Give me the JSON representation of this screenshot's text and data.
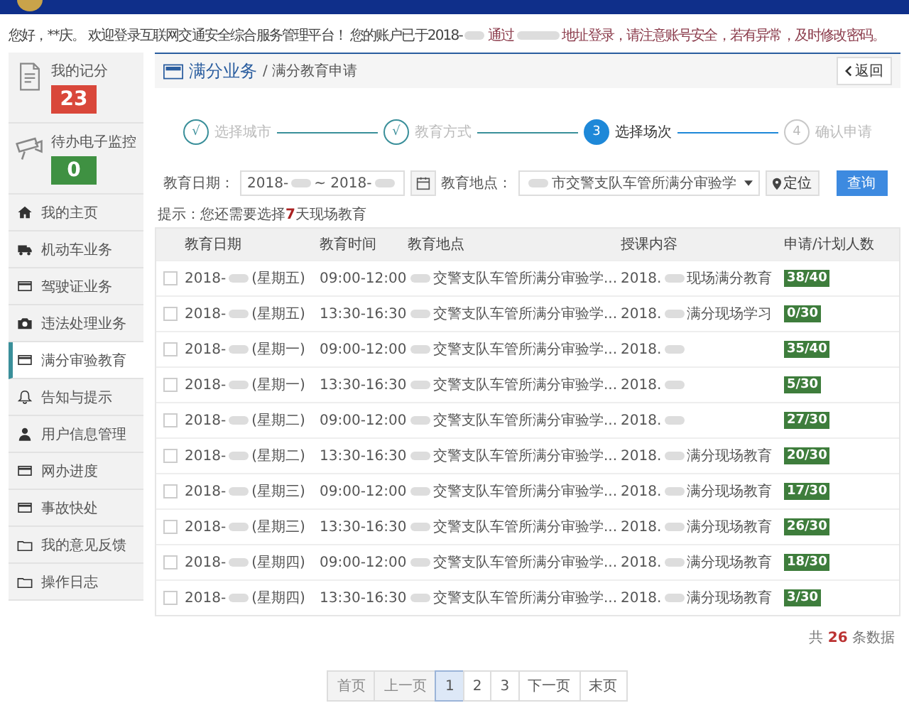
{
  "greeting": {
    "before": "您好，**庆。 欢迎登录互联网交通安全综合服务管理平台！ 您的账户已于2018-",
    "middle": "通过",
    "after": "地址登录，请注意账号安全，若有异常，及时修改密码。"
  },
  "sidebar": {
    "cards": [
      {
        "label": "我的记分",
        "value": "23",
        "color": "#d9473a"
      },
      {
        "label": "待办电子监控",
        "value": "0",
        "color": "#3f9142"
      }
    ],
    "items": [
      {
        "label": "我的主页",
        "selected": false
      },
      {
        "label": "机动车业务",
        "selected": false
      },
      {
        "label": "驾驶证业务",
        "selected": false
      },
      {
        "label": "违法处理业务",
        "selected": false
      },
      {
        "label": "满分审验教育",
        "selected": true
      },
      {
        "label": "告知与提示",
        "selected": false
      },
      {
        "label": "用户信息管理",
        "selected": false
      },
      {
        "label": "网办进度",
        "selected": false
      },
      {
        "label": "事故快处",
        "selected": false
      },
      {
        "label": "我的意见反馈",
        "selected": false
      },
      {
        "label": "操作日志",
        "selected": false
      }
    ]
  },
  "breadcrumb": {
    "section": "满分业务",
    "page": "/ 满分教育申请",
    "back": "返回"
  },
  "steps": [
    {
      "marker": "√",
      "label": "选择城市",
      "kind": "done"
    },
    {
      "marker": "√",
      "label": "教育方式",
      "kind": "done"
    },
    {
      "marker": "3",
      "label": "选择场次",
      "kind": "current"
    },
    {
      "marker": "4",
      "label": "确认申请",
      "kind": "todo"
    }
  ],
  "filters": {
    "date_label": "教育日期：",
    "date_from": "2018-",
    "date_to": "~ 2018-",
    "place_label": "教育地点：",
    "place_value": "市交警支队车管所满分审验学",
    "locate": "定位",
    "search": "查询"
  },
  "hint": "提示：您还需要选择**7**天现场教育",
  "table": {
    "columns": [
      "教育日期",
      "教育时间",
      "教育地点",
      "授课内容",
      "申请/计划人数"
    ],
    "rows": [
      {
        "date": "2018-",
        "weekday": "(星期五)",
        "time": "09:00-12:00",
        "place": "交警支队车管所满分审验学...",
        "content_prefix": "2018.",
        "content": "现场满分教育",
        "count": "38/40",
        "checked": false
      },
      {
        "date": "2018-",
        "weekday": "(星期五)",
        "time": "13:30-16:30",
        "place": "交警支队车管所满分审验学...",
        "content_prefix": "2018.",
        "content": "满分现场学习",
        "count": "0/30",
        "checked": false
      },
      {
        "date": "2018-",
        "weekday": "(星期一)",
        "time": "09:00-12:00",
        "place": "交警支队车管所满分审验学...",
        "content_prefix": "2018.",
        "count": "35/40",
        "checked": false
      },
      {
        "date": "2018-",
        "weekday": "(星期一)",
        "time": "13:30-16:30",
        "place": "交警支队车管所满分审验学...",
        "content_prefix": "2018.",
        "count": "5/30",
        "checked": false
      },
      {
        "date": "2018-",
        "weekday": "(星期二)",
        "time": "09:00-12:00",
        "place": "交警支队车管所满分审验学...",
        "content_prefix": "2018.",
        "count": "27/30",
        "checked": false
      },
      {
        "date": "2018-",
        "weekday": "(星期二)",
        "time": "13:30-16:30",
        "place": "交警支队车管所满分审验学...",
        "content_prefix": "2018.",
        "content": "满分现场教育",
        "count": "20/30",
        "checked": false
      },
      {
        "date": "2018-",
        "weekday": "(星期三)",
        "time": "09:00-12:00",
        "place": "交警支队车管所满分审验学...",
        "content_prefix": "2018.",
        "content": "满分现场教育",
        "count": "17/30",
        "checked": false
      },
      {
        "date": "2018-",
        "weekday": "(星期三)",
        "time": "13:30-16:30",
        "place": "交警支队车管所满分审验学...",
        "content_prefix": "2018.",
        "content": "满分现场教育",
        "count": "26/30",
        "checked": false
      },
      {
        "date": "2018-",
        "weekday": "(星期四)",
        "time": "09:00-12:00",
        "place": "交警支队车管所满分审验学...",
        "content_prefix": "2018.",
        "content": "满分现场教育",
        "count": "18/30",
        "checked": false
      },
      {
        "date": "2018-",
        "weekday": "(星期四)",
        "time": "13:30-16:30",
        "place": "交警支队车管所满分审验学...",
        "content_prefix": "2018.",
        "content": "满分现场教育",
        "count": "3/30",
        "checked": false
      }
    ]
  },
  "total": "共 **26** 条数据",
  "pagination": [
    {
      "label": "首页",
      "disabled": true,
      "selected": false
    },
    {
      "label": "上一页",
      "disabled": true,
      "selected": false
    },
    {
      "label": "1",
      "disabled": false,
      "selected": true
    },
    {
      "label": "2",
      "disabled": false,
      "selected": false
    },
    {
      "label": "3",
      "disabled": false,
      "selected": false
    },
    {
      "label": "下一页",
      "disabled": false,
      "selected": false
    },
    {
      "label": "末页",
      "disabled": false,
      "selected": false
    }
  ]
}
